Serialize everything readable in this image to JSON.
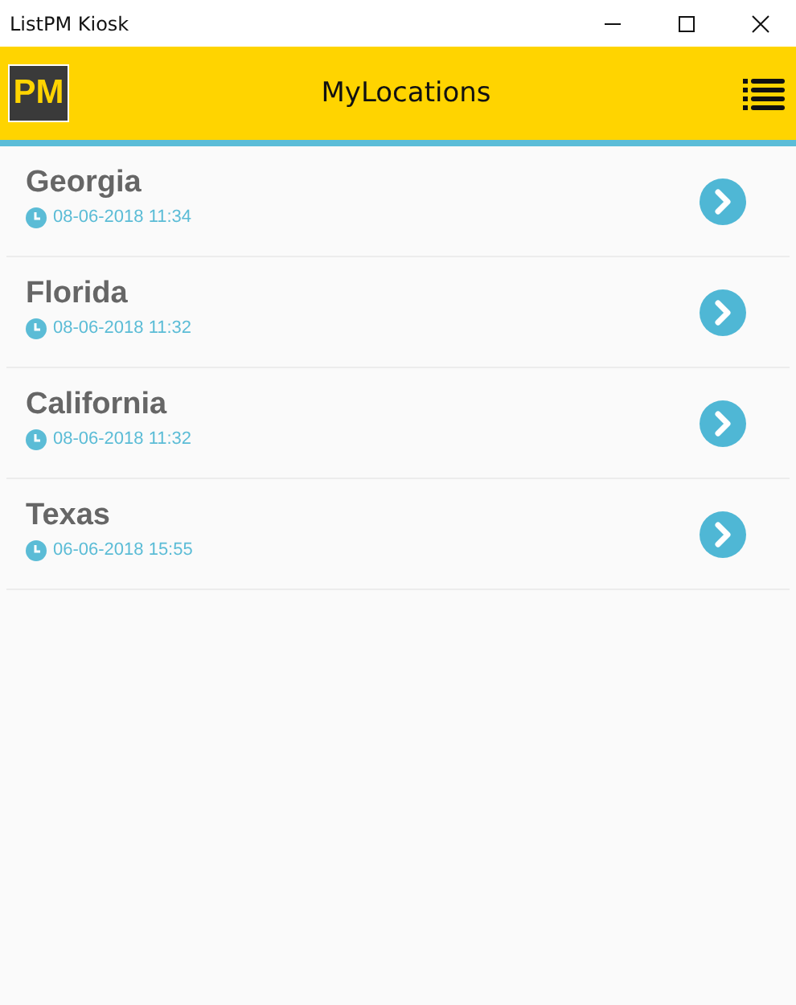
{
  "window": {
    "title": "ListPM Kiosk"
  },
  "header": {
    "logo": "PM",
    "title": "MyLocations"
  },
  "locations": [
    {
      "name": "Georgia",
      "time": "08-06-2018 11:34"
    },
    {
      "name": "Florida",
      "time": "08-06-2018 11:32"
    },
    {
      "name": "California",
      "time": "08-06-2018 11:32"
    },
    {
      "name": "Texas",
      "time": "06-06-2018 15:55"
    }
  ]
}
